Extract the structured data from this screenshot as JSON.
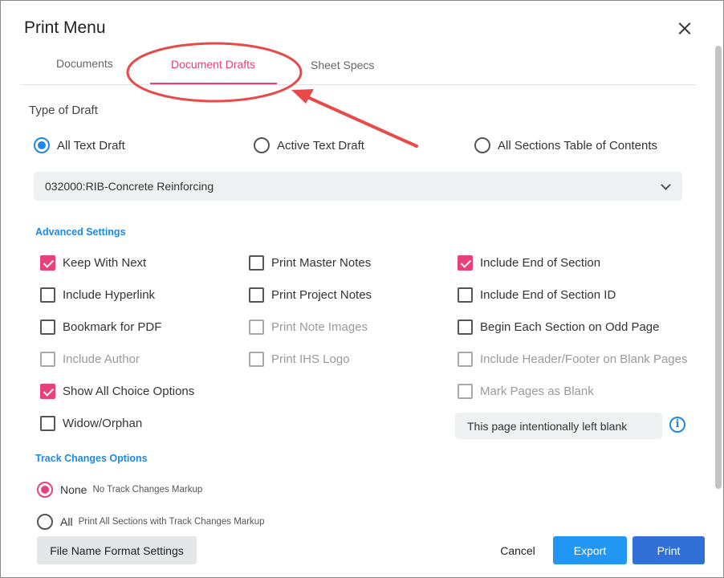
{
  "dialog": {
    "title": "Print Menu"
  },
  "tabs": [
    {
      "label": "Documents"
    },
    {
      "label": "Document Drafts",
      "active": true
    },
    {
      "label": "Sheet Specs"
    }
  ],
  "draft_type": {
    "title": "Type of Draft",
    "options": [
      {
        "label": "All Text Draft",
        "selected": true
      },
      {
        "label": "Active Text Draft",
        "selected": false
      },
      {
        "label": "All Sections Table of Contents",
        "selected": false
      }
    ],
    "section_select": {
      "value": "032000:RIB-Concrete Reinforcing"
    }
  },
  "advanced": {
    "title": "Advanced Settings",
    "col1": [
      {
        "label": "Keep With Next",
        "checked": true,
        "disabled": false
      },
      {
        "label": "Include Hyperlink",
        "checked": false,
        "disabled": false
      },
      {
        "label": "Bookmark for PDF",
        "checked": false,
        "disabled": false
      },
      {
        "label": "Include Author",
        "checked": false,
        "disabled": true
      },
      {
        "label": "Show All Choice Options",
        "checked": true,
        "disabled": false
      },
      {
        "label": "Widow/Orphan",
        "checked": false,
        "disabled": false
      }
    ],
    "col2": [
      {
        "label": "Print Master Notes",
        "checked": false,
        "disabled": false
      },
      {
        "label": "Print Project Notes",
        "checked": false,
        "disabled": false
      },
      {
        "label": "Print Note Images",
        "checked": false,
        "disabled": true
      },
      {
        "label": "Print IHS Logo",
        "checked": false,
        "disabled": true
      }
    ],
    "col3": [
      {
        "label": "Include End of Section",
        "checked": true,
        "disabled": false
      },
      {
        "label": "Include End of Section ID",
        "checked": false,
        "disabled": false
      },
      {
        "label": "Begin Each Section on Odd Page",
        "checked": false,
        "disabled": false
      },
      {
        "label": "Include Header/Footer on Blank Pages",
        "checked": false,
        "disabled": true
      },
      {
        "label": "Mark Pages as Blank",
        "checked": false,
        "disabled": true
      }
    ],
    "blank_page_text": "This page intentionally left blank",
    "info_icon": "info-icon"
  },
  "track_changes": {
    "title": "Track Changes Options",
    "options": [
      {
        "label": "None",
        "desc": "No Track Changes Markup",
        "selected": true
      },
      {
        "label": "All",
        "desc": "Print All Sections with Track Changes Markup",
        "selected": false
      }
    ]
  },
  "footer": {
    "file_name_format": "File Name Format Settings",
    "cancel": "Cancel",
    "export": "Export",
    "print": "Print"
  },
  "colors": {
    "accent_pink": "#e8407a",
    "accent_blue": "#1e88e5",
    "annotation_red": "#e84a4a"
  }
}
